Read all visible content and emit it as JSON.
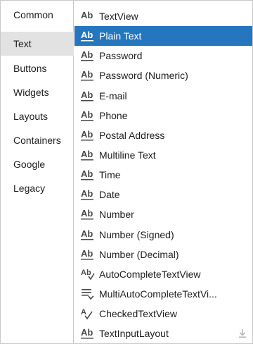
{
  "categories": [
    {
      "label": "Common"
    },
    {
      "label": "Text"
    },
    {
      "label": "Buttons"
    },
    {
      "label": "Widgets"
    },
    {
      "label": "Layouts"
    },
    {
      "label": "Containers"
    },
    {
      "label": "Google"
    },
    {
      "label": "Legacy"
    }
  ],
  "active_category": "Text",
  "items": [
    {
      "label": "TextView",
      "icon": "textview-icon"
    },
    {
      "label": "Plain Text",
      "icon": "edittext-icon"
    },
    {
      "label": "Password",
      "icon": "edittext-icon"
    },
    {
      "label": "Password (Numeric)",
      "icon": "edittext-icon"
    },
    {
      "label": "E-mail",
      "icon": "edittext-icon"
    },
    {
      "label": "Phone",
      "icon": "edittext-icon"
    },
    {
      "label": "Postal Address",
      "icon": "edittext-icon"
    },
    {
      "label": "Multiline Text",
      "icon": "edittext-icon"
    },
    {
      "label": "Time",
      "icon": "edittext-icon"
    },
    {
      "label": "Date",
      "icon": "edittext-icon"
    },
    {
      "label": "Number",
      "icon": "edittext-icon"
    },
    {
      "label": "Number (Signed)",
      "icon": "edittext-icon"
    },
    {
      "label": "Number (Decimal)",
      "icon": "edittext-icon"
    },
    {
      "label": "AutoCompleteTextView",
      "icon": "autocomplete-icon"
    },
    {
      "label": "MultiAutoCompleteTextVi...",
      "icon": "multiautocomplete-icon"
    },
    {
      "label": "CheckedTextView",
      "icon": "checkedtext-icon"
    },
    {
      "label": "TextInputLayout",
      "icon": "edittext-icon",
      "download": "download-icon"
    }
  ],
  "selected_item": "Plain Text",
  "colors": {
    "selection": "#2675bf",
    "active_category": "#e2e2e2",
    "border": "#c9c9c9"
  }
}
